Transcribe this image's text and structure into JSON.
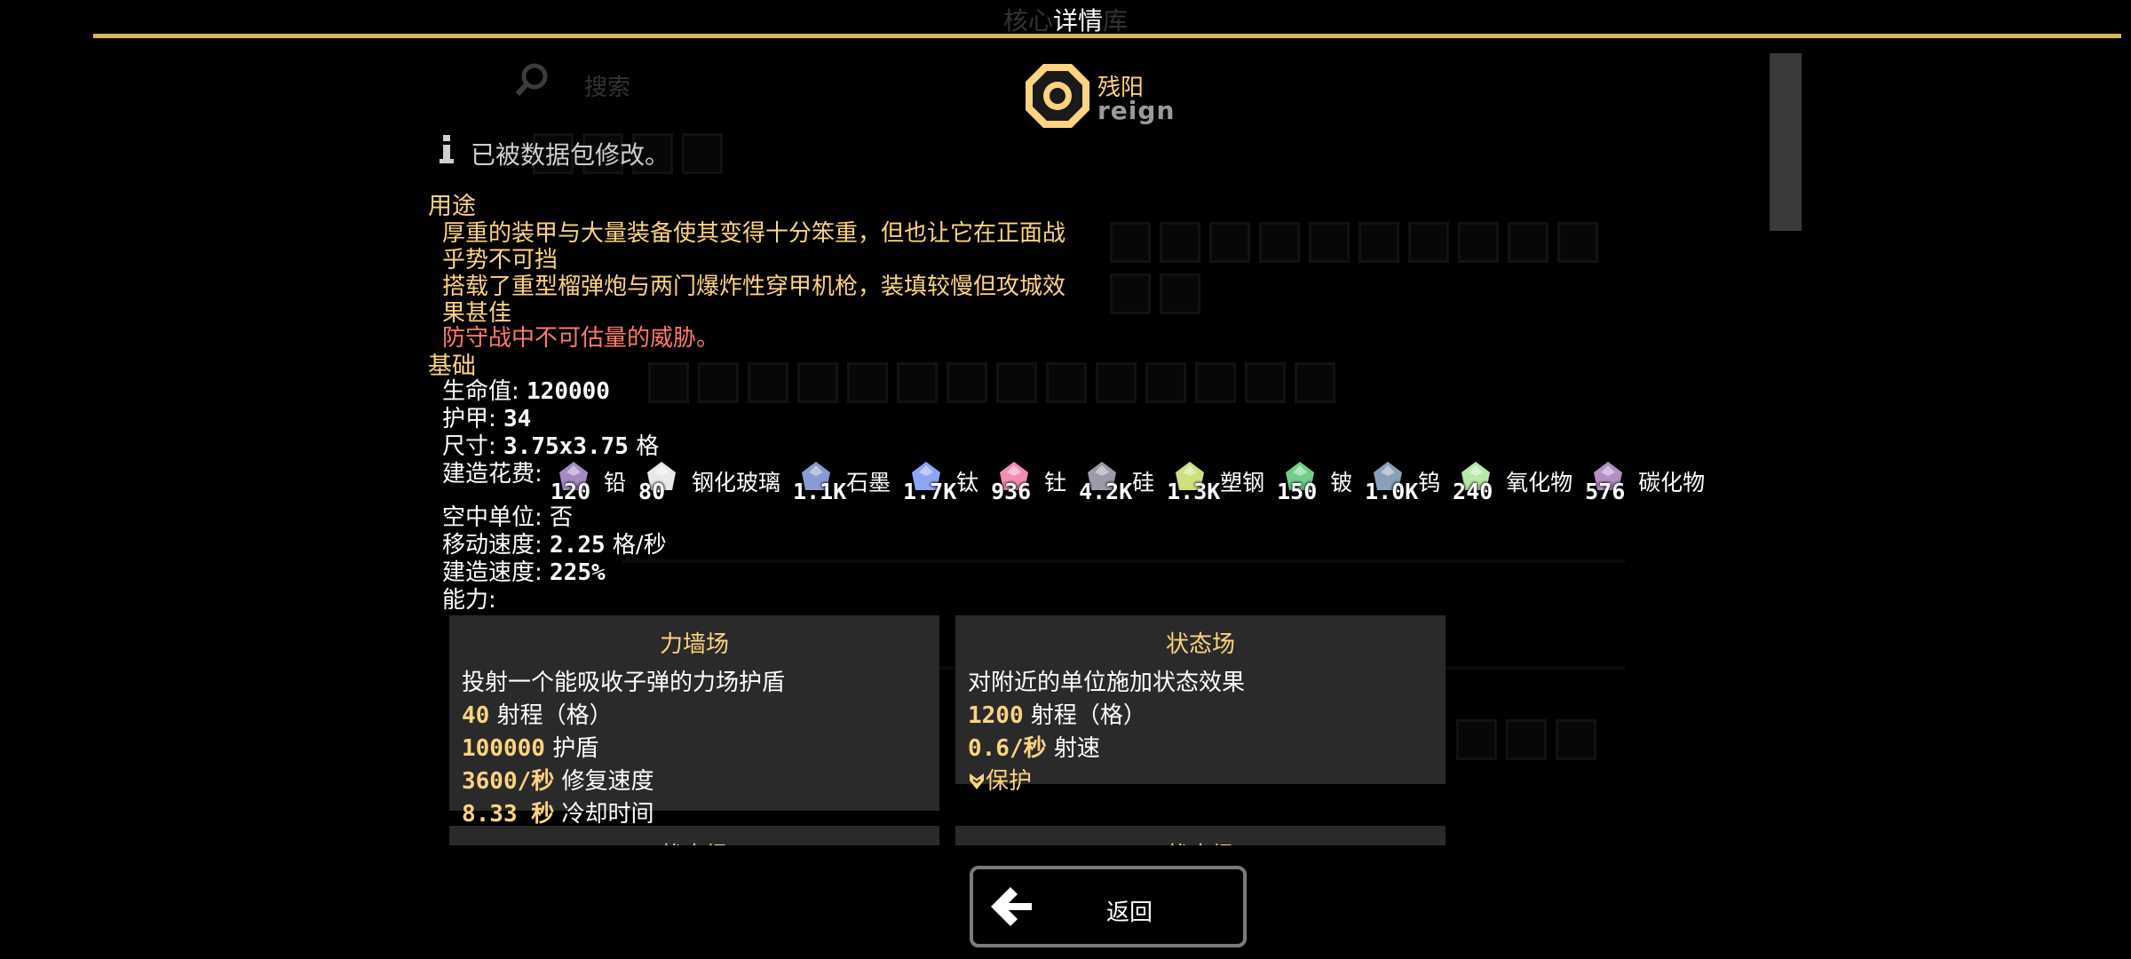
{
  "header": {
    "title": "详情",
    "ghost_left": "核心",
    "ghost_right": "库"
  },
  "search": {
    "placeholder": "搜索"
  },
  "unit": {
    "name": "残阳",
    "internal_name": "reign",
    "modified_note": "已被数据包修改。"
  },
  "usage": {
    "heading": "用途",
    "lines": [
      "厚重的装甲与大量装备使其变得十分笨重，但也让它在正面战",
      "乎势不可挡",
      "搭载了重型榴弹炮与两门爆炸性穿甲机枪，装填较慢但攻城效",
      "果甚佳",
      "防守战中不可估量的威胁。"
    ]
  },
  "basic": {
    "heading": "基础",
    "health_label": "生命值:",
    "health": "120000",
    "armor_label": "护甲:",
    "armor": "34",
    "size_label": "尺寸:",
    "size": "3.75x3.75",
    "size_unit": "格",
    "cost_label": "建造花费:",
    "costs": [
      {
        "amount": "120",
        "name": "铅",
        "color": "#a48ac8",
        "icon": "lead-icon"
      },
      {
        "amount": "80",
        "name": "钢化玻璃",
        "color": "#e8e8e8",
        "icon": "metaglass-icon"
      },
      {
        "amount": "1.1K",
        "name": "石墨",
        "color": "#8a9ad4",
        "icon": "graphite-icon"
      },
      {
        "amount": "1.7K",
        "name": "钛",
        "color": "#8da5f4",
        "icon": "titanium-icon"
      },
      {
        "amount": "936",
        "name": "钍",
        "color": "#f58bb3",
        "icon": "thorium-icon"
      },
      {
        "amount": "4.2K",
        "name": "硅",
        "color": "#9a9aa8",
        "icon": "silicon-icon"
      },
      {
        "amount": "1.3K",
        "name": "塑钢",
        "color": "#cde07f",
        "icon": "plastanium-icon"
      },
      {
        "amount": "150",
        "name": "铍",
        "color": "#6fcf8a",
        "icon": "beryllium-icon"
      },
      {
        "amount": "1.0K",
        "name": "钨",
        "color": "#8aa0b8",
        "icon": "tungsten-icon"
      },
      {
        "amount": "240",
        "name": "氧化物",
        "color": "#b7e8a8",
        "icon": "oxide-icon"
      },
      {
        "amount": "576",
        "name": "碳化物",
        "color": "#b58fc7",
        "icon": "carbide-icon"
      }
    ],
    "flying_label": "空中单位:",
    "flying": "否",
    "speed_label": "移动速度:",
    "speed": "2.25",
    "speed_unit": "格/秒",
    "build_speed_label": "建造速度:",
    "build_speed": "225%",
    "abilities_label": "能力:"
  },
  "abilities": [
    {
      "title": "力墙场",
      "desc": "投射一个能吸收子弹的力场护盾",
      "stats": [
        {
          "num": "40",
          "text": "射程（格）"
        },
        {
          "num": "100000",
          "text": "护盾"
        },
        {
          "num": "3600/秒",
          "text": "修复速度"
        },
        {
          "num": "8.33 秒",
          "text": "冷却时间"
        }
      ]
    },
    {
      "title": "状态场",
      "desc": "对附近的单位施加状态效果",
      "stats": [
        {
          "num": "1200",
          "text": "射程（格）"
        },
        {
          "num": "0.6/秒",
          "text": "射速"
        }
      ],
      "effect": "保护"
    }
  ],
  "abilities_next": [
    "状态场",
    "状态场"
  ],
  "back_button": {
    "label": "返回"
  },
  "colors": {
    "accent": "#ffd37f",
    "bar": "#d9b45f",
    "danger": "#ff7a6b",
    "panel": "#2a2a2a"
  }
}
